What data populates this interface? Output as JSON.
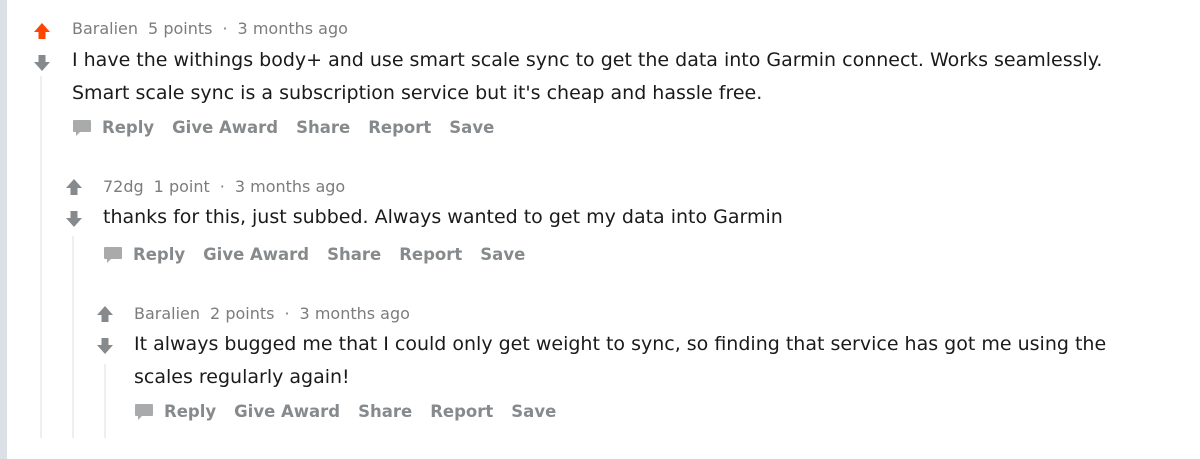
{
  "colors": {
    "upvote_active": "#ff4500",
    "vote_neutral": "#878a8c",
    "muted_text": "#7c7c7c",
    "thread_line": "#edeff1"
  },
  "comments": [
    {
      "author": "Baralien",
      "points": "5 points",
      "separator": "·",
      "time": "3 months ago",
      "upvoted": true,
      "body_lines": [
        "I have the withings body+ and use smart scale sync to get the data into Garmin connect. Works seamlessly.",
        "Smart scale sync is a subscription service but it's cheap and hassle free."
      ],
      "actions": {
        "reply": "Reply",
        "give_award": "Give Award",
        "share": "Share",
        "report": "Report",
        "save": "Save"
      }
    },
    {
      "author": "72dg",
      "points": "1 point",
      "separator": "·",
      "time": "3 months ago",
      "upvoted": false,
      "body_lines": [
        "thanks for this, just subbed. Always wanted to get my data into Garmin"
      ],
      "actions": {
        "reply": "Reply",
        "give_award": "Give Award",
        "share": "Share",
        "report": "Report",
        "save": "Save"
      }
    },
    {
      "author": "Baralien",
      "points": "2 points",
      "separator": "·",
      "time": "3 months ago",
      "upvoted": false,
      "body_lines": [
        "It always bugged me that I could only get weight to sync, so finding that service has got me using the",
        "scales regularly again!"
      ],
      "actions": {
        "reply": "Reply",
        "give_award": "Give Award",
        "share": "Share",
        "report": "Report",
        "save": "Save"
      }
    }
  ]
}
